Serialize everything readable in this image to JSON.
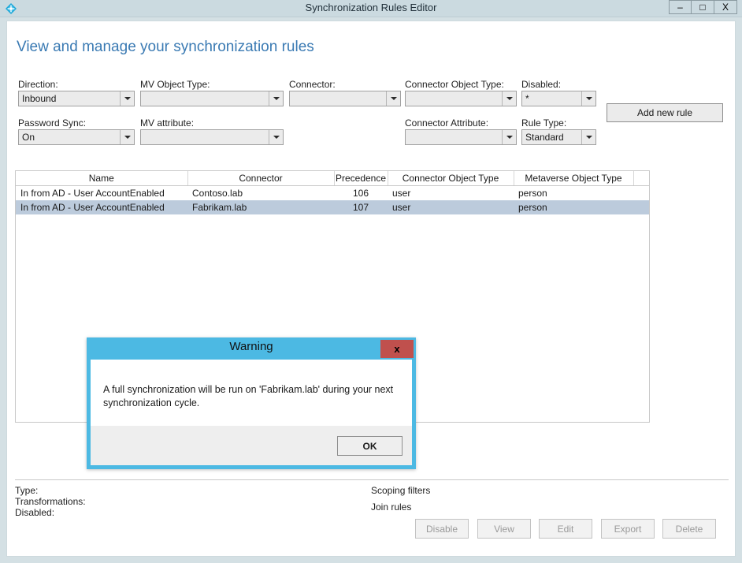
{
  "window": {
    "title": "Synchronization Rules Editor",
    "icon": "diamond-app-icon",
    "controls": {
      "minimize": "–",
      "maximize": "□",
      "close": "X"
    }
  },
  "page": {
    "heading": "View and manage your synchronization rules"
  },
  "filters": {
    "direction": {
      "label": "Direction:",
      "value": "Inbound"
    },
    "mv_object_type": {
      "label": "MV Object Type:",
      "value": ""
    },
    "connector": {
      "label": "Connector:",
      "value": ""
    },
    "connector_object_type": {
      "label": "Connector Object Type:",
      "value": ""
    },
    "disabled": {
      "label": "Disabled:",
      "value": "*"
    },
    "password_sync": {
      "label": "Password Sync:",
      "value": "On"
    },
    "mv_attribute": {
      "label": "MV attribute:",
      "value": ""
    },
    "connector_attribute": {
      "label": "Connector Attribute:",
      "value": ""
    },
    "rule_type": {
      "label": "Rule Type:",
      "value": "Standard"
    },
    "add_new_rule": "Add new rule"
  },
  "grid": {
    "columns": [
      "Name",
      "Connector",
      "Precedence",
      "Connector Object Type",
      "Metaverse Object Type",
      ""
    ],
    "rows": [
      {
        "name": "In from AD - User AccountEnabled",
        "connector": "Contoso.lab",
        "precedence": "106",
        "connector_object_type": "user",
        "metaverse_object_type": "person",
        "selected": false
      },
      {
        "name": "In from AD - User AccountEnabled",
        "connector": "Fabrikam.lab",
        "precedence": "107",
        "connector_object_type": "user",
        "metaverse_object_type": "person",
        "selected": true
      }
    ]
  },
  "details": {
    "type_label": "Type:",
    "transformations_label": "Transformations:",
    "disabled_label": "Disabled:",
    "scoping_filters_link": "Scoping filters",
    "join_rules_link": "Join rules"
  },
  "actions": {
    "disable": "Disable",
    "view": "View",
    "edit": "Edit",
    "export": "Export",
    "delete": "Delete"
  },
  "dialog": {
    "title": "Warning",
    "close_label": "x",
    "message": "A full synchronization will be run on 'Fabrikam.lab' during your next synchronization cycle.",
    "ok_label": "OK"
  },
  "colors": {
    "title_bar": "#cbdae0",
    "window_frame": "#d4e0e4",
    "heading": "#3a7ab3",
    "dialog_border": "#4cb9e3",
    "dialog_close": "#c0504d",
    "row_selected": "#bccbdc"
  }
}
